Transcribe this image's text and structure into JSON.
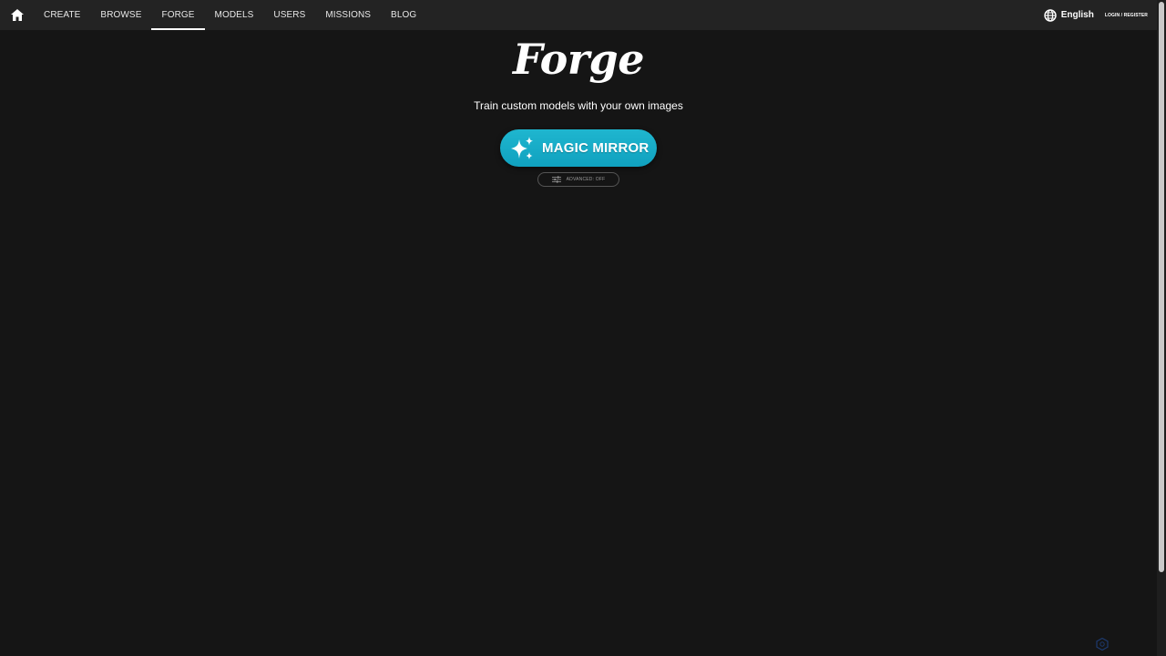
{
  "nav": {
    "home_icon": "home-icon",
    "items": [
      "CREATE",
      "BROWSE",
      "FORGE",
      "MODELS",
      "USERS",
      "MISSIONS",
      "BLOG"
    ],
    "active": "FORGE",
    "language": "English",
    "language_icon": "globe-icon",
    "login": "LOGIN / REGISTER"
  },
  "hero": {
    "title": "Forge",
    "subtitle": "Train custom models with your own images",
    "primary_button": "MAGIC MIRROR",
    "primary_icon": "sparkles-icon",
    "advanced_button": "ADVANCED: OFF",
    "advanced_icon": "sliders-icon"
  },
  "colors": {
    "background": "#151515",
    "topbar": "#232323",
    "accent": "#18aec9"
  }
}
